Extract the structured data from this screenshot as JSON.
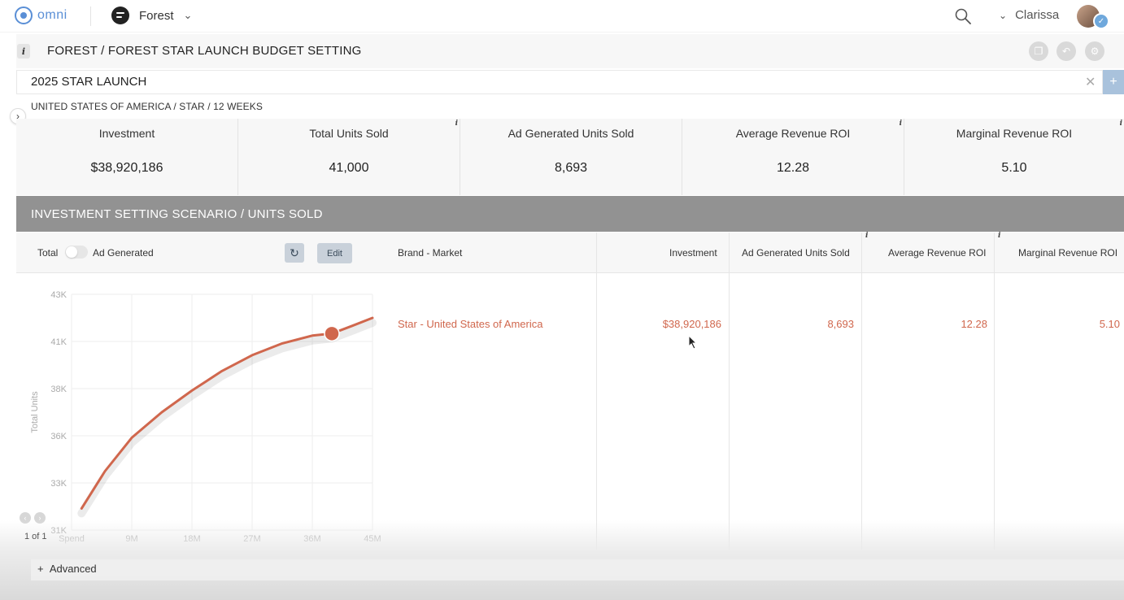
{
  "nav": {
    "logo_text": "omni",
    "workspace": "Forest",
    "user_name": "Clarissa"
  },
  "page": {
    "title": "FOREST / FOREST STAR LAUNCH BUDGET SETTING",
    "scenario_name": "2025 STAR LAUNCH",
    "subtitle": "UNITED STATES OF AMERICA / STAR / 12 WEEKS"
  },
  "kpis": [
    {
      "label": "Investment",
      "value": "$38,920,186"
    },
    {
      "label": "Total Units Sold",
      "value": "41,000"
    },
    {
      "label": "Ad Generated Units Sold",
      "value": "8,693"
    },
    {
      "label": "Average Revenue ROI",
      "value": "12.28"
    },
    {
      "label": "Marginal Revenue ROI",
      "value": "5.10"
    }
  ],
  "section": {
    "title": "INVESTMENT SETTING SCENARIO / UNITS SOLD"
  },
  "controls": {
    "total_label": "Total",
    "ad_generated_label": "Ad Generated",
    "edit_label": "Edit"
  },
  "table": {
    "columns": [
      "Brand - Market",
      "Investment",
      "Ad Generated Units Sold",
      "Average Revenue ROI",
      "Marginal Revenue ROI"
    ],
    "rows": [
      [
        "Star - United States of America",
        "$38,920,186",
        "8,693",
        "12.28",
        "5.10"
      ]
    ]
  },
  "pager": {
    "text": "1 of 1"
  },
  "advanced": {
    "label": "Advanced"
  },
  "colors": {
    "accent": "#d0674d",
    "section_band": "#929292",
    "brand_blue": "#5a8fd6"
  },
  "chart_data": {
    "type": "line",
    "title": "",
    "xlabel": "",
    "ylabel": "Total Units",
    "x_tick_labels": [
      "Spend",
      "9M",
      "18M",
      "27M",
      "36M",
      "45M"
    ],
    "y_tick_labels": [
      "31K",
      "33K",
      "36K",
      "38K",
      "41K",
      "43K"
    ],
    "xlim": [
      0,
      45000000
    ],
    "ylim": [
      31000,
      43000
    ],
    "series": [
      {
        "x": [
          1500000,
          5000000,
          9000000,
          13500000,
          18000000,
          22500000,
          27000000,
          31500000,
          36000000,
          38920186,
          42000000,
          45000000
        ],
        "y": [
          32100,
          34000,
          35700,
          37000,
          38100,
          39100,
          39900,
          40500,
          40900,
          41000,
          41400,
          41800
        ]
      }
    ],
    "highlight_point": {
      "x": 38920186,
      "y": 41000
    },
    "grid": true,
    "color": "#d0674d"
  }
}
